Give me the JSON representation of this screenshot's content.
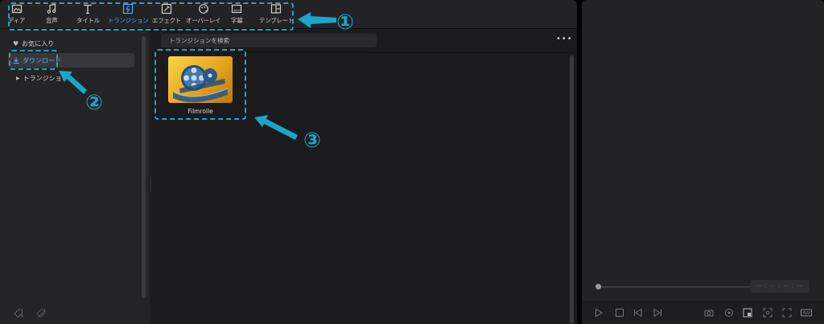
{
  "toolbar": {
    "tabs": [
      {
        "label": "ディア",
        "icon": "media-icon"
      },
      {
        "label": "音声",
        "icon": "music-note-icon"
      },
      {
        "label": "タイトル",
        "icon": "title-t-icon"
      },
      {
        "label": "トランジション",
        "icon": "transition-icon",
        "active": true
      },
      {
        "label": "エフェクト",
        "icon": "effects-icon"
      },
      {
        "label": "オーバーレイ",
        "icon": "overlay-icon"
      },
      {
        "label": "字幕",
        "icon": "subtitle-icon"
      },
      {
        "label": "テンプレート",
        "icon": "template-icon"
      }
    ]
  },
  "sidebar": {
    "favorites": "お気に入り",
    "download": "ダウンロード",
    "transitions": "トランジション"
  },
  "content": {
    "search_placeholder": "トランジションを検索",
    "items": [
      {
        "label": "Filmrolle"
      }
    ]
  },
  "preview": {
    "timecode": "-- : -- : -- : --"
  },
  "annotations": {
    "n1": "①",
    "n2": "②",
    "n3": "③",
    "color": "#1aa6c8"
  },
  "colors": {
    "accent": "#4aa3ff",
    "panel": "#1e1e1e"
  }
}
